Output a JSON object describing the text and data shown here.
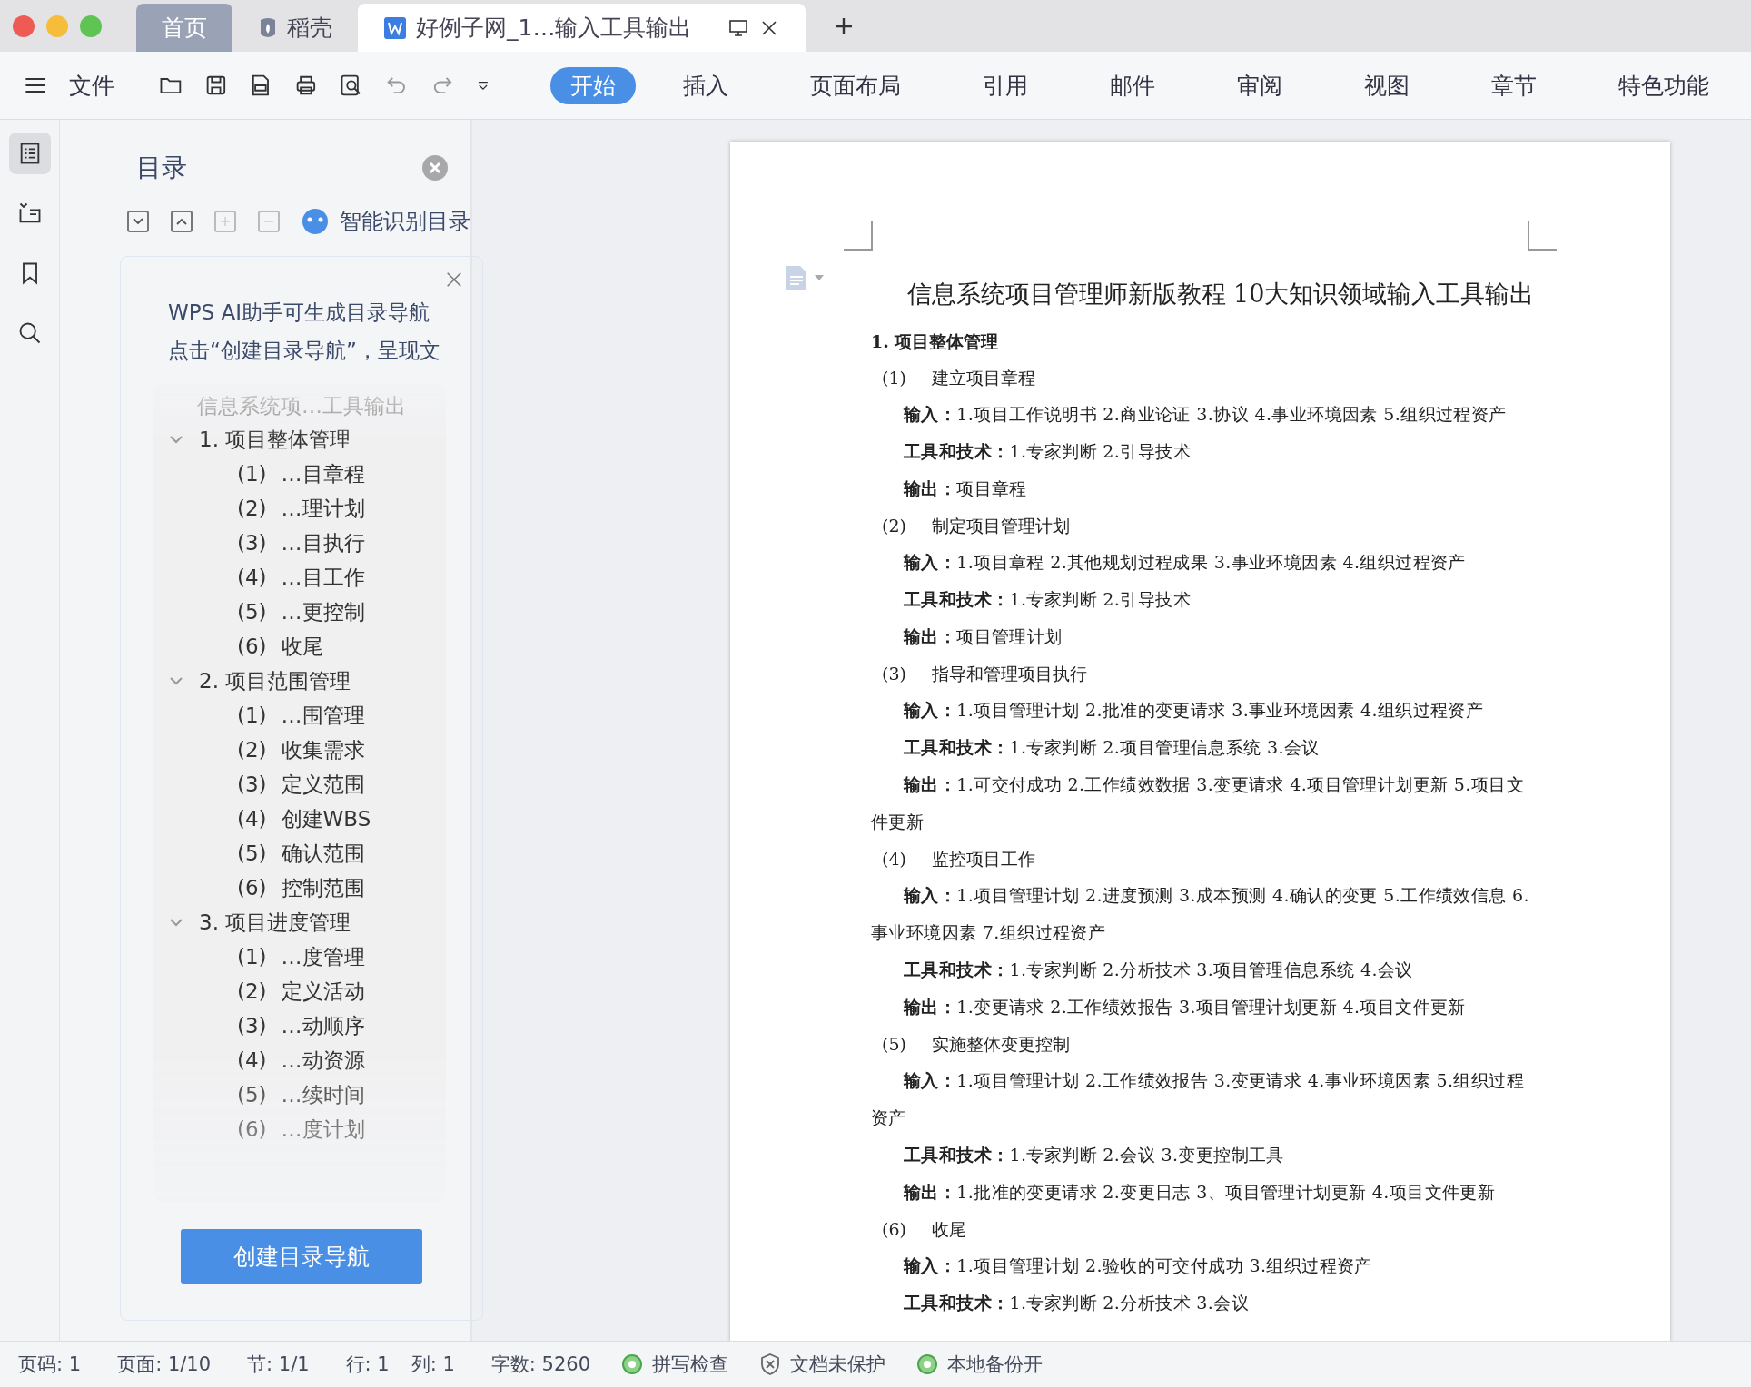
{
  "window_tabs": [
    {
      "label": "首页",
      "kind": "home",
      "selected": false
    },
    {
      "label": "稻壳",
      "kind": "docer",
      "selected": false
    },
    {
      "label": "好例子网_1…输入工具输出",
      "kind": "document",
      "selected": true
    }
  ],
  "toolbar": {
    "file_menu": "文件",
    "ribbon_tabs": [
      {
        "label": "开始",
        "selected": true
      },
      {
        "label": "插入",
        "selected": false
      },
      {
        "label": "页面布局",
        "selected": false
      },
      {
        "label": "引用",
        "selected": false
      },
      {
        "label": "邮件",
        "selected": false
      },
      {
        "label": "审阅",
        "selected": false
      },
      {
        "label": "视图",
        "selected": false
      },
      {
        "label": "章节",
        "selected": false
      },
      {
        "label": "特色功能",
        "selected": false
      }
    ]
  },
  "side_rail": [
    {
      "kind": "toc",
      "selected": true
    },
    {
      "kind": "outline",
      "selected": false
    },
    {
      "kind": "bookmark",
      "selected": false
    },
    {
      "kind": "search",
      "selected": false
    }
  ],
  "toc_panel": {
    "title": "目录",
    "smart_button": "智能识别目录",
    "ai_card": {
      "lines": [
        "WPS AI助手可生成目录导航",
        "点击“创建目录导航”，呈现文"
      ],
      "button": "创建目录导航"
    },
    "root": "信息系统项…工具输出",
    "items": [
      {
        "label": "1. 项目整体管理",
        "expanded": true,
        "children": [
          {
            "number": "(1)",
            "label": "…目章程"
          },
          {
            "number": "(2)",
            "label": "…理计划"
          },
          {
            "number": "(3)",
            "label": "…目执行"
          },
          {
            "number": "(4)",
            "label": "…目工作"
          },
          {
            "number": "(5)",
            "label": "…更控制"
          },
          {
            "number": "(6)",
            "label": "收尾"
          }
        ]
      },
      {
        "label": "2. 项目范围管理",
        "expanded": true,
        "children": [
          {
            "number": "(1)",
            "label": "…围管理"
          },
          {
            "number": "(2)",
            "label": "收集需求"
          },
          {
            "number": "(3)",
            "label": "定义范围"
          },
          {
            "number": "(4)",
            "label": "创建WBS"
          },
          {
            "number": "(5)",
            "label": "确认范围"
          },
          {
            "number": "(6)",
            "label": "控制范围"
          }
        ]
      },
      {
        "label": "3. 项目进度管理",
        "expanded": true,
        "children": [
          {
            "number": "(1)",
            "label": "…度管理"
          },
          {
            "number": "(2)",
            "label": "定义活动"
          },
          {
            "number": "(3)",
            "label": "…动顺序"
          },
          {
            "number": "(4)",
            "label": "…动资源"
          },
          {
            "number": "(5)",
            "label": "…续时间"
          },
          {
            "number": "(6)",
            "label": "…度计划"
          }
        ]
      }
    ]
  },
  "document": {
    "title": "信息系统项目管理师新版教程 10大知识领域输入工具输出",
    "paragraphs": [
      {
        "kind": "heading",
        "text": "1. 项目整体管理"
      },
      {
        "kind": "sub",
        "number": "(1)",
        "text": "建立项目章程"
      },
      {
        "kind": "field",
        "text": "**输入：**1.项目工作说明书 2.商业论证 3.协议 4.事业环境因素 5.组织过程资产"
      },
      {
        "kind": "field",
        "text": "**工具和技术：**1.专家判断 2.引导技术"
      },
      {
        "kind": "field",
        "text": "**输出：**项目章程"
      },
      {
        "kind": "sub",
        "number": "(2)",
        "text": "制定项目管理计划"
      },
      {
        "kind": "field",
        "text": "**输入：**1.项目章程 2.其他规划过程成果 3.事业环境因素 4.组织过程资产"
      },
      {
        "kind": "field",
        "text": "**工具和技术：**1.专家判断 2.引导技术"
      },
      {
        "kind": "field",
        "text": "**输出：**项目管理计划"
      },
      {
        "kind": "sub",
        "number": "(3)",
        "text": "指导和管理项目执行"
      },
      {
        "kind": "field",
        "text": "**输入：**1.项目管理计划 2.批准的变更请求 3.事业环境因素 4.组织过程资产"
      },
      {
        "kind": "field",
        "text": "**工具和技术：**1.专家判断 2.项目管理信息系统 3.会议"
      },
      {
        "kind": "field",
        "text": "**输出：**1.可交付成功 2.工作绩效数据 3.变更请求 4.项目管理计划更新 5.项目文件更新"
      },
      {
        "kind": "sub",
        "number": "(4)",
        "text": "监控项目工作"
      },
      {
        "kind": "field",
        "text": "**输入：**1.项目管理计划 2.进度预测 3.成本预测 4.确认的变更 5.工作绩效信息 6.事业环境因素 7.组织过程资产"
      },
      {
        "kind": "field",
        "text": "**工具和技术：**1.专家判断 2.分析技术 3.项目管理信息系统 4.会议"
      },
      {
        "kind": "field",
        "text": "**输出：**1.变更请求 2.工作绩效报告 3.项目管理计划更新 4.项目文件更新"
      },
      {
        "kind": "sub",
        "number": "(5)",
        "text": "实施整体变更控制"
      },
      {
        "kind": "field",
        "text": "**输入：**1.项目管理计划 2.工作绩效报告 3.变更请求 4.事业环境因素 5.组织过程资产"
      },
      {
        "kind": "field",
        "text": "**工具和技术：**1.专家判断 2.会议 3.变更控制工具"
      },
      {
        "kind": "field",
        "text": "**输出：**1.批准的变更请求 2.变更日志 3、项目管理计划更新 4.项目文件更新"
      },
      {
        "kind": "sub",
        "number": "(6)",
        "text": "收尾"
      },
      {
        "kind": "field",
        "text": "**输入：**1.项目管理计划 2.验收的可交付成功 3.组织过程资产"
      },
      {
        "kind": "field",
        "text": "**工具和技术：**1.专家判断 2.分析技术 3.会议"
      }
    ]
  },
  "status_bar": [
    {
      "kind": "text",
      "label": "页码: 1"
    },
    {
      "kind": "text",
      "label": "页面: 1/10"
    },
    {
      "kind": "text",
      "label": "节: 1/1"
    },
    {
      "kind": "text",
      "label": "行: 1"
    },
    {
      "kind": "text",
      "label": "列: 1"
    },
    {
      "kind": "text",
      "label": "字数: 5260"
    },
    {
      "kind": "spell",
      "label": "拼写检查"
    },
    {
      "kind": "protect",
      "label": "文档未保护"
    },
    {
      "kind": "backup",
      "label": "本地备份开"
    }
  ]
}
